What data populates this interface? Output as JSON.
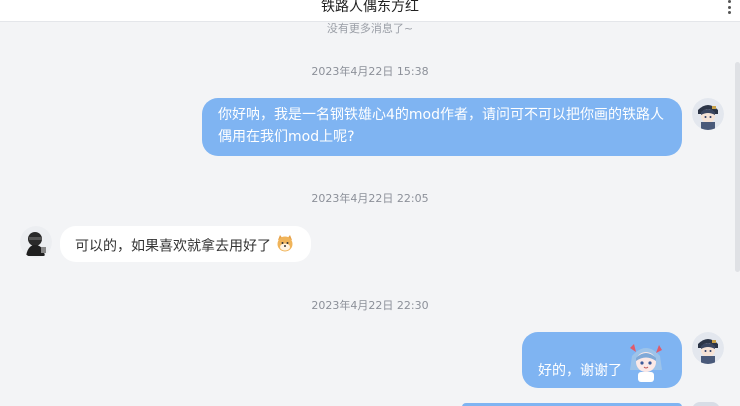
{
  "header": {
    "title": "铁路人偶东方红",
    "menu_icon": "more-vertical-icon"
  },
  "history_note": "没有更多消息了~",
  "colors": {
    "page_background": "#f3f4f6",
    "my_bubble": "#7fb4f2",
    "their_bubble": "#ffffff",
    "timestamp_text": "#8c9099"
  },
  "messages": [
    {
      "timestamp": "2023年4月22日 15:38",
      "sender": "me",
      "avatar_icon": "anime-character-avatar-icon",
      "text_line1": "你好呐，我是一名钢铁雄心4的mod作者，请问可不可以把你画的铁路人",
      "text_line2": "偶用在我们mod上呢?"
    },
    {
      "timestamp": "2023年4月22日 22:05",
      "sender": "other",
      "avatar_icon": "dark-hooded-figure-avatar-icon",
      "text": "可以的，如果喜欢就拿去用好了",
      "emoji_icon": "shiba-dog-emoji-icon"
    },
    {
      "timestamp": "2023年4月22日 22:30",
      "sender": "me",
      "avatar_icon": "anime-character-avatar-icon",
      "text": "好的，谢谢了",
      "sticker_icon": "anime-girl-sticker-icon"
    }
  ]
}
